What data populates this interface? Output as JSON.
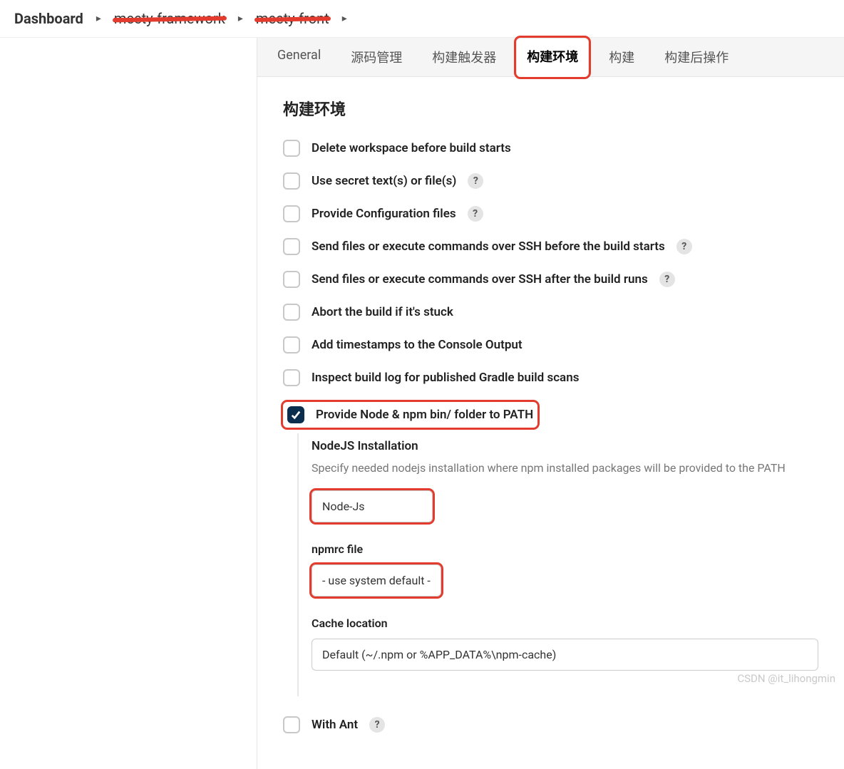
{
  "breadcrumbs": {
    "items": [
      "Dashboard",
      "meety-framework",
      "meety-front"
    ]
  },
  "tabs": {
    "items": [
      {
        "label": "General"
      },
      {
        "label": "源码管理"
      },
      {
        "label": "构建触发器"
      },
      {
        "label": "构建环境",
        "active": true
      },
      {
        "label": "构建"
      },
      {
        "label": "构建后操作"
      }
    ]
  },
  "section": {
    "title": "构建环境"
  },
  "options": {
    "delete_ws": "Delete workspace before build starts",
    "secret": "Use secret text(s) or file(s)",
    "config_files": "Provide Configuration files",
    "ssh_before": "Send files or execute commands over SSH before the build starts",
    "ssh_after": "Send files or execute commands over SSH after the build runs",
    "abort_stuck": "Abort the build if it's stuck",
    "timestamps": "Add timestamps to the Console Output",
    "gradle_scans": "Inspect build log for published Gradle build scans",
    "node_path": "Provide Node & npm bin/ folder to PATH",
    "with_ant": "With Ant"
  },
  "node_section": {
    "title": "NodeJS Installation",
    "desc": "Specify needed nodejs installation where npm installed packages will be provided to the PATH",
    "install_value": "Node-Js",
    "npmrc_label": "npmrc file",
    "npmrc_value": "- use system default -",
    "cache_label": "Cache location",
    "cache_value": "Default (~/.npm or %APP_DATA%\\npm-cache)"
  },
  "help_icon": "?",
  "watermark": "CSDN @it_lihongmin"
}
